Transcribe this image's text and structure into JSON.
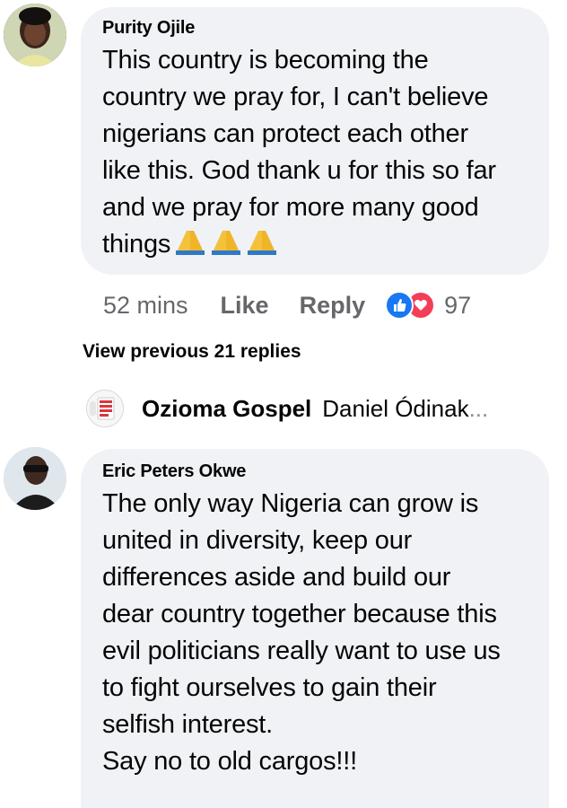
{
  "comment1": {
    "author": "Purity Ojile",
    "text": "This country is becoming the\ncountry we pray for, I can't believe\nnigerians can protect each other\nlike this. God thank u for this so far\nand we pray for more  many good\nthings",
    "emoji": "folded-hands x3",
    "time": "52 mins",
    "like_label": "Like",
    "reply_label": "Reply",
    "reaction_count": "97",
    "reactions": [
      "like-icon",
      "love-icon"
    ]
  },
  "view_previous": "View previous 21 replies",
  "reply_preview": {
    "name": "Ozioma Gospel",
    "snippet": "Daniel Ódinak",
    "ellipsis": "..."
  },
  "comment2": {
    "author": "Eric Peters Okwe",
    "text": "The only way Nigeria can grow is\nunited in diversity, keep our\ndifferences aside and build our\ndear country together because this\nevil politicians really want to use us\nto fight ourselves to gain their\nselfish interest.\nSay no to old cargos!!!"
  },
  "colors": {
    "bubble": "#f0f2f5",
    "meta_text": "#65676b",
    "like_blue": "#1877f2",
    "love_red": "#f33e58"
  }
}
